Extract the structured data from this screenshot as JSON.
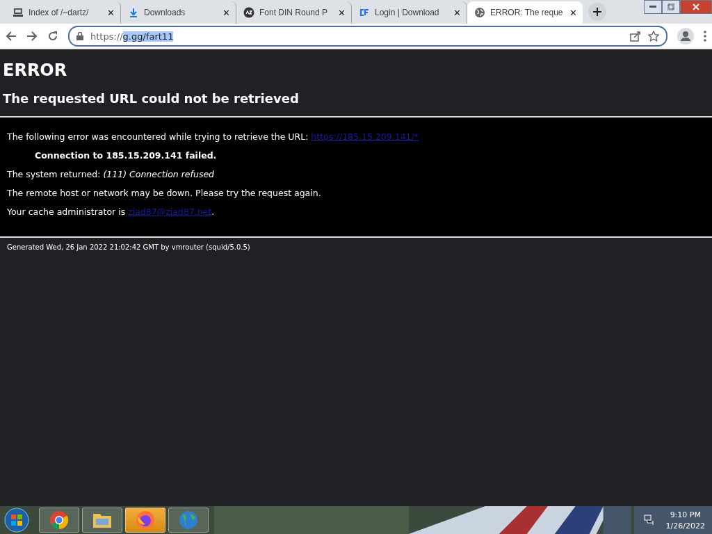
{
  "tabs": [
    {
      "label": "Index of /~dartz/",
      "kind": "computer",
      "close": "✕",
      "selected": false
    },
    {
      "label": "Downloads",
      "kind": "download",
      "close": "✕",
      "selected": false
    },
    {
      "label": "Font DIN Round P",
      "kind": "az",
      "close": "✕",
      "selected": false
    },
    {
      "label": "Login | Download",
      "kind": "cf",
      "close": "✕",
      "selected": false
    },
    {
      "label": "ERROR: The reque",
      "kind": "globe",
      "close": "✕",
      "selected": true
    }
  ],
  "address": {
    "prefix": "https://",
    "selected_text": "g.gg/fart11"
  },
  "page": {
    "heading": "ERROR",
    "subheading": "The requested URL could not be retrieved",
    "intro": "The following error was encountered while trying to retrieve the URL:",
    "intro_link": "https://185.15.209.141/*",
    "failure": "Connection to 185.15.209.141 failed.",
    "returned_label": "The system returned:",
    "returned_value": "(111) Connection refused",
    "advice": "The remote host or network may be down. Please try the request again.",
    "admin_label": "Your cache administrator is",
    "admin_link": "ziad87@ziad87.net",
    "admin_end": ".",
    "footer": "Generated Wed, 26 Jan 2022 21:02:42 GMT by vmrouter (squid/5.0.5)"
  },
  "taskbar": {
    "apps": [
      {
        "kind": "chrome",
        "active": false
      },
      {
        "kind": "folder",
        "active": false
      },
      {
        "kind": "firefox",
        "active": true
      },
      {
        "kind": "globe",
        "active": false
      }
    ],
    "time": "9:10 PM",
    "date": "1/26/2022"
  }
}
